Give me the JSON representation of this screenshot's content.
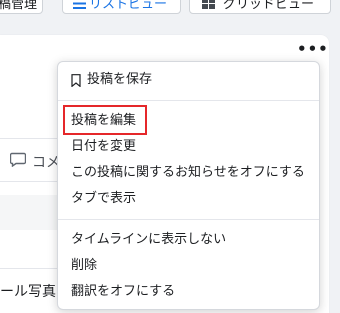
{
  "toolbar": {
    "manage_label": "稿管理",
    "list_label": "リストビュー",
    "grid_label": "グリッドビュー"
  },
  "post": {
    "more_label": "•••",
    "comment_label": "コメ",
    "bottom_text": "ール写真"
  },
  "menu": {
    "save_post": "投稿を保存",
    "edit_post": "投稿を編集",
    "change_date": "日付を変更",
    "notifications_off": "この投稿に関するお知らせをオフにする",
    "show_in_tab": "タブで表示",
    "hide_from_timeline": "タイムラインに表示しない",
    "delete": "削除",
    "translation_off": "翻訳をオフにする"
  },
  "colors": {
    "highlight": "#e5272a",
    "accent": "#1b74e4"
  }
}
